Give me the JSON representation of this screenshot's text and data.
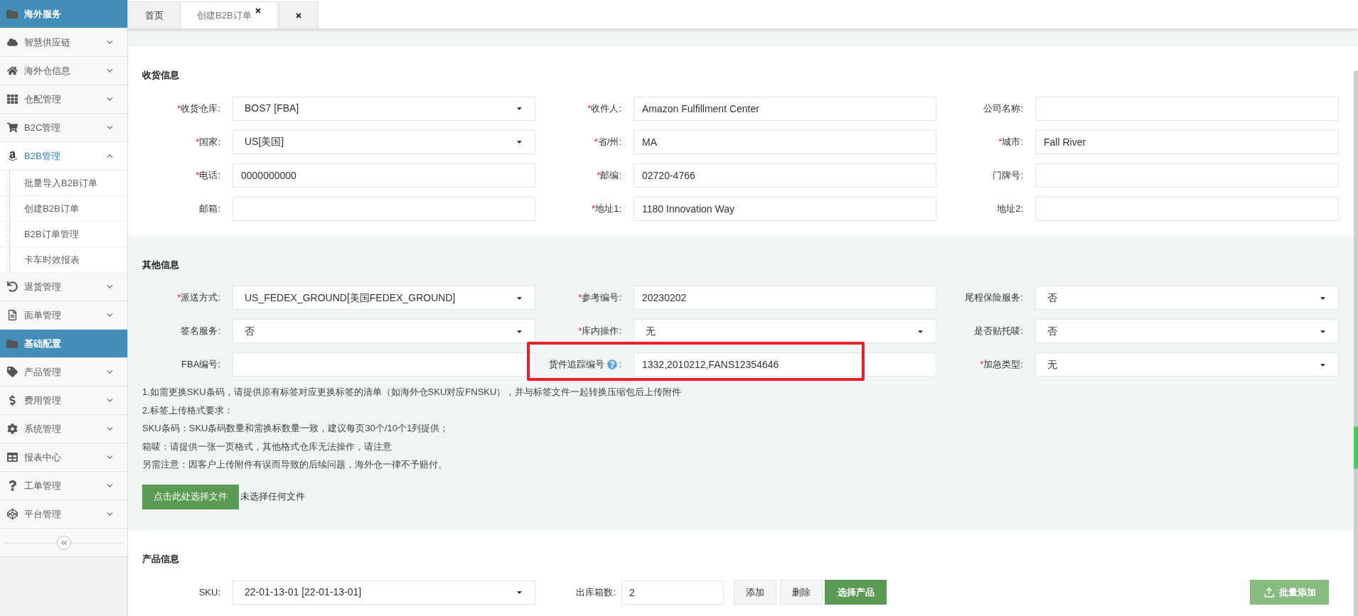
{
  "sidebar": {
    "items": [
      {
        "kind": "header",
        "label": "海外服务"
      },
      {
        "kind": "menu",
        "label": "智慧供应链",
        "expanded": false
      },
      {
        "kind": "menu",
        "label": "海外仓信息",
        "expanded": false
      },
      {
        "kind": "menu",
        "label": "仓配管理",
        "expanded": false
      },
      {
        "kind": "menu",
        "label": "B2C管理",
        "expanded": false
      },
      {
        "kind": "menu",
        "label": "B2B管理",
        "expanded": true,
        "children": [
          {
            "label": "批量导入B2B订单"
          },
          {
            "label": "创建B2B订单"
          },
          {
            "label": "B2B订单管理"
          },
          {
            "label": "卡车时效报表"
          }
        ]
      },
      {
        "kind": "menu",
        "label": "退货管理",
        "expanded": false
      },
      {
        "kind": "menu",
        "label": "面单管理",
        "expanded": false
      },
      {
        "kind": "header",
        "label": "基础配置"
      },
      {
        "kind": "menu",
        "label": "产品管理",
        "expanded": false
      },
      {
        "kind": "menu",
        "label": "费用管理",
        "expanded": false
      },
      {
        "kind": "menu",
        "label": "系统管理",
        "expanded": false
      },
      {
        "kind": "menu",
        "label": "报表中心",
        "expanded": false
      },
      {
        "kind": "menu",
        "label": "工单管理",
        "expanded": false
      },
      {
        "kind": "menu",
        "label": "平台管理",
        "expanded": false
      }
    ]
  },
  "tabs": [
    {
      "label": "首页",
      "selected": false,
      "closable": false
    },
    {
      "label": "创建B2B订单",
      "selected": true,
      "closable": true
    },
    {
      "selected": false,
      "closable": true
    }
  ],
  "receiver": {
    "title": "收货信息",
    "fields": [
      {
        "kind": "select",
        "label": "收货仓库:",
        "mark": "*",
        "value": "BOS7 [FBA]"
      },
      {
        "kind": "input",
        "label": "收件人:",
        "mark": "*",
        "value": "Amazon Fulfillment Center"
      },
      {
        "kind": "input",
        "label": "公司名称:"
      },
      {
        "kind": "select",
        "label": "国家:",
        "mark": "*",
        "value": "US[美国]"
      },
      {
        "kind": "input",
        "label": "省/州:",
        "mark": "*",
        "value": "MA"
      },
      {
        "kind": "input",
        "label": "城市:",
        "mark": "*",
        "value": "Fall River"
      },
      {
        "kind": "input",
        "label": "电话:",
        "mark": "*",
        "value": "0000000000"
      },
      {
        "kind": "input",
        "label": "邮编:",
        "mark": "*",
        "value": "02720-4766"
      },
      {
        "kind": "input",
        "label": "门牌号:"
      },
      {
        "kind": "input",
        "label": "邮箱:"
      },
      {
        "kind": "input",
        "label": "地址1:",
        "mark": "*",
        "value": "1180 Innovation Way"
      },
      {
        "kind": "input",
        "label": "地址2:"
      }
    ]
  },
  "other": {
    "title": "其他信息",
    "fields": [
      {
        "kind": "select",
        "label": "派送方式:",
        "mark": "*",
        "value": "US_FEDEX_GROUND[美国FEDEX_GROUND]"
      },
      {
        "kind": "input",
        "label": "参考编号:",
        "mark": "*",
        "value": "20230202"
      },
      {
        "kind": "select",
        "label": "尾程保险服务:",
        "value": "否"
      },
      {
        "kind": "select",
        "label": "签名服务:",
        "value": "否"
      },
      {
        "kind": "select",
        "label": "库内操作:",
        "mark": "*",
        "value": "无"
      },
      {
        "kind": "select",
        "label": "是否贴托唛:",
        "value": "否"
      },
      {
        "kind": "input",
        "label": "FBA编号:"
      },
      {
        "kind": "input",
        "label": "货件追踪编号",
        "help": true,
        "colon": ":",
        "value": "1332,2010212,FANS12354646",
        "highlighted": true
      },
      {
        "kind": "select",
        "label": "加急类型:",
        "mark": "*",
        "value": "无"
      }
    ],
    "notes": [
      "1.如需更换SKU条码，请提供原有标签对应更换标签的清单（如海外仓SKU对应FNSKU），并与标签文件一起转换压缩包后上传附件",
      "2.标签上传格式要求：",
      "SKU条码：SKU条码数量和需换标数量一致，建议每页30个/10个1列提供；",
      "箱唛：请提供一张一页格式，其他格式仓库无法操作，请注意",
      "另需注意：因客户上传附件有误而导致的后续问题，海外仓一律不予赔付。"
    ],
    "file_button": "点击此处选择文件",
    "file_status": "未选择任何文件"
  },
  "product": {
    "title": "产品信息",
    "sku_label": "SKU:",
    "sku_value": "22-01-13-01 [22-01-13-01]",
    "boxes_label": "出库箱数:",
    "boxes_value": "2",
    "add": "添加",
    "delete": "删除",
    "choose": "选择产品",
    "bulk_add": "批量添加"
  }
}
